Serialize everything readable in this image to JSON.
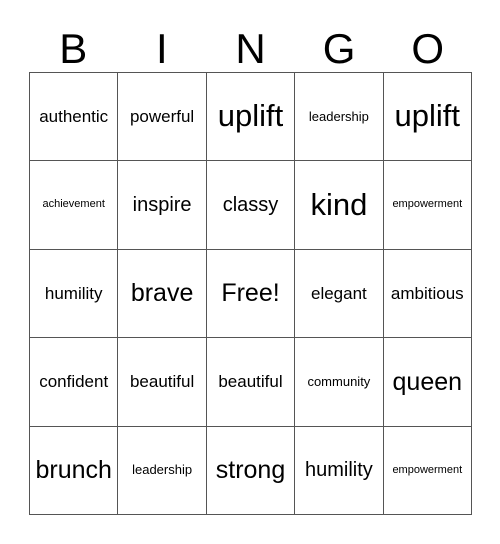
{
  "header": {
    "letters": [
      "B",
      "I",
      "N",
      "G",
      "O"
    ]
  },
  "card": {
    "columns": 5,
    "rows": 5,
    "border_color": "#555555",
    "text_color": "#000000",
    "background_color": "#ffffff",
    "free_space": "Free!",
    "cells": [
      {
        "text": "authentic",
        "size": "s-md"
      },
      {
        "text": "powerful",
        "size": "s-md"
      },
      {
        "text": "uplift",
        "size": "s-xxl"
      },
      {
        "text": "leadership",
        "size": "s-sm"
      },
      {
        "text": "uplift",
        "size": "s-xxl"
      },
      {
        "text": "achievement",
        "size": "s-xs"
      },
      {
        "text": "inspire",
        "size": "s-lg"
      },
      {
        "text": "classy",
        "size": "s-lg"
      },
      {
        "text": "kind",
        "size": "s-xxl"
      },
      {
        "text": "empowerment",
        "size": "s-xs"
      },
      {
        "text": "humility",
        "size": "s-md"
      },
      {
        "text": "brave",
        "size": "s-xl"
      },
      {
        "text": "Free!",
        "size": "s-xl"
      },
      {
        "text": "elegant",
        "size": "s-md"
      },
      {
        "text": "ambitious",
        "size": "s-md"
      },
      {
        "text": "confident",
        "size": "s-md"
      },
      {
        "text": "beautiful",
        "size": "s-md"
      },
      {
        "text": "beautiful",
        "size": "s-md"
      },
      {
        "text": "community",
        "size": "s-sm"
      },
      {
        "text": "queen",
        "size": "s-xl"
      },
      {
        "text": "brunch",
        "size": "s-xl"
      },
      {
        "text": "leadership",
        "size": "s-sm"
      },
      {
        "text": "strong",
        "size": "s-xl"
      },
      {
        "text": "humility",
        "size": "s-lg"
      },
      {
        "text": "empowerment",
        "size": "s-xs"
      }
    ]
  }
}
